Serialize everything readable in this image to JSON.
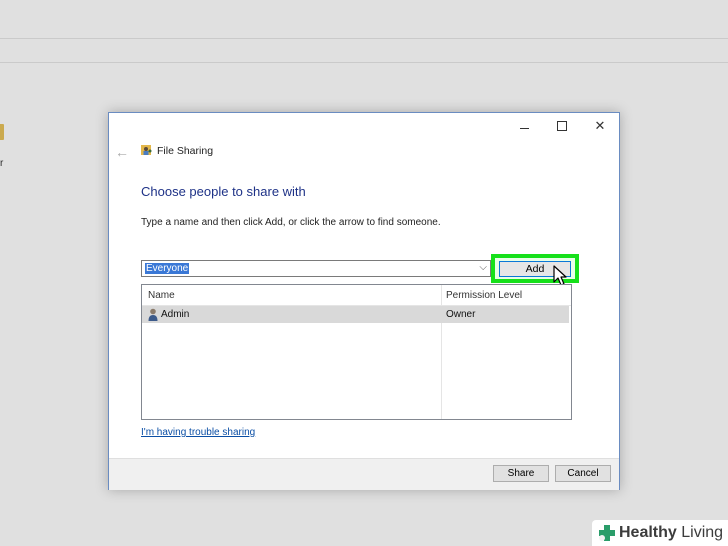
{
  "background": {
    "partial_label": "r"
  },
  "dialog": {
    "title": "File Sharing",
    "heading": "Choose people to share with",
    "instruction": "Type a name and then click Add, or click the arrow to find someone.",
    "combo": {
      "value": "Everyone"
    },
    "add_label": "Add",
    "list": {
      "columns": [
        "Name",
        "Permission Level"
      ],
      "rows": [
        {
          "name": "Admin",
          "permission": "Owner"
        }
      ]
    },
    "trouble_link": "I'm having trouble sharing",
    "share_label": "Share",
    "cancel_label": "Cancel"
  },
  "watermark": {
    "text_bold": "Healthy",
    "text_light": "Living"
  },
  "colors": {
    "highlight": "#16e01a",
    "heading": "#1e3287",
    "selection": "#3a78d6",
    "link": "#0a4ea5"
  },
  "icons": [
    "back-arrow-icon",
    "file-sharing-icon",
    "minimize-icon",
    "maximize-icon",
    "close-icon",
    "chevron-down-icon",
    "user-icon",
    "mouse-pointer-icon",
    "healthy-living-logo-icon"
  ]
}
